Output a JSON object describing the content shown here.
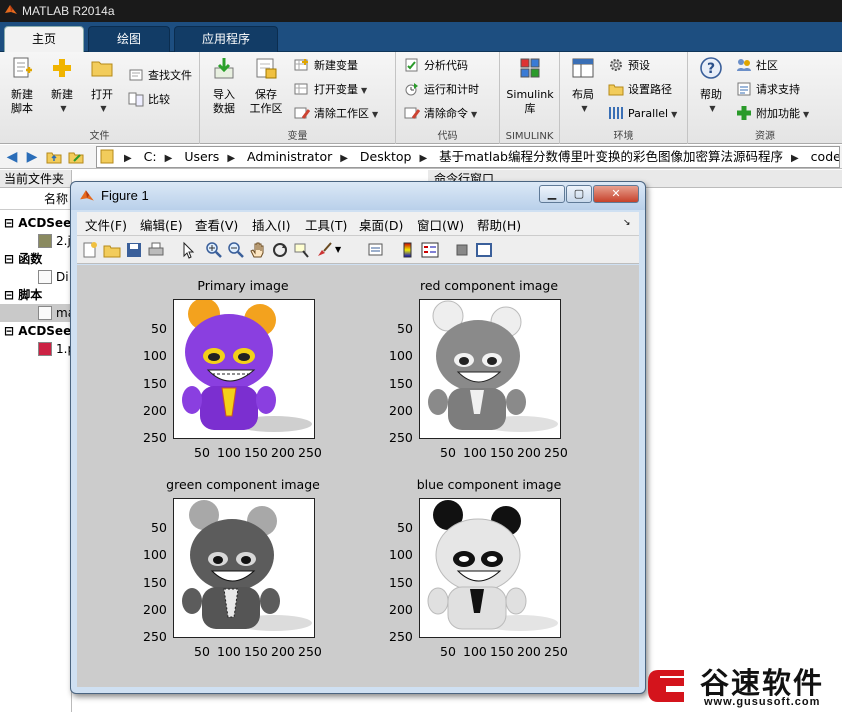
{
  "app": {
    "title": "MATLAB R2014a"
  },
  "ribbon_tabs": [
    {
      "label": "主页",
      "active": true
    },
    {
      "label": "绘图",
      "active": false
    },
    {
      "label": "应用程序",
      "active": false
    }
  ],
  "ribbon": {
    "file": {
      "new_script": "新建\n脚本",
      "new": "新建",
      "open": "打开",
      "find_files": "查找文件",
      "compare": "比较",
      "title": "文件"
    },
    "variable": {
      "import": "导入\n数据",
      "save_ws": "保存\n工作区",
      "new_var": "新建变量",
      "open_var": "打开变量",
      "clear_ws": "清除工作区",
      "title": "变量"
    },
    "code": {
      "analyze": "分析代码",
      "run_time": "运行和计时",
      "clear_cmd": "清除命令",
      "title": "代码"
    },
    "simulink": {
      "lib": "Simulink\n库",
      "title": "SIMULINK"
    },
    "env": {
      "layout": "布局",
      "prefs": "预设",
      "set_path": "设置路径",
      "parallel": "Parallel",
      "title": "环境"
    },
    "resources": {
      "help": "帮助",
      "community": "社区",
      "support": "请求支持",
      "addons": "附加功能",
      "title": "资源"
    }
  },
  "path": [
    "C:",
    "Users",
    "Administrator",
    "Desktop",
    "基于matlab编程分数傅里叶变换的彩色图像加密算法源码程序",
    "code"
  ],
  "left_panel": {
    "title": "当前文件夹",
    "column": "名称",
    "rows": [
      {
        "label": "ACDSee",
        "bold": true
      },
      {
        "label": "2.j",
        "bold": false
      },
      {
        "label": "函数",
        "bold": true
      },
      {
        "label": "Di",
        "bold": false
      },
      {
        "label": "脚本",
        "bold": true
      },
      {
        "label": "ma",
        "bold": false
      },
      {
        "label": "ACDSee",
        "bold": true
      },
      {
        "label": "1.p",
        "bold": false
      }
    ]
  },
  "command_window": {
    "title": "命令行窗口"
  },
  "figure": {
    "title": "Figure 1",
    "menu": [
      "文件(F)",
      "编辑(E)",
      "查看(V)",
      "插入(I)",
      "工具(T)",
      "桌面(D)",
      "窗口(W)",
      "帮助(H)"
    ],
    "subplots": [
      {
        "title": "Primary image"
      },
      {
        "title": "red component image"
      },
      {
        "title": "green component image"
      },
      {
        "title": "blue component image"
      }
    ],
    "yticks": [
      "50",
      "100",
      "150",
      "200",
      "250"
    ],
    "xticks": [
      "50",
      "100",
      "150",
      "200",
      "250"
    ]
  },
  "watermark": {
    "name": "谷速软件",
    "url": "www.gususoft.com"
  },
  "colors": {
    "tabstrip": "#1d4e80",
    "figure_bg": "#cccccc",
    "doll_purple": "#8a3fe0",
    "watermark_red": "#d4141c"
  }
}
